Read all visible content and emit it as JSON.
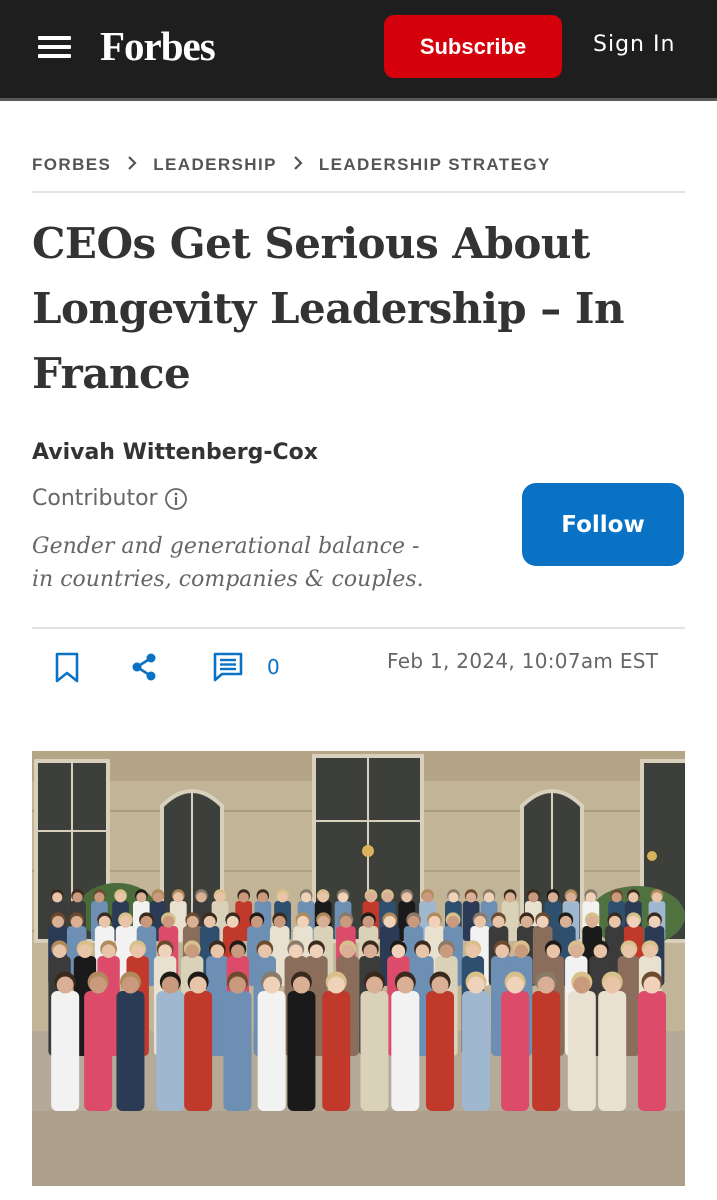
{
  "header": {
    "logo": "Forbes",
    "subscribe_label": "Subscribe",
    "signin_label": "Sign In"
  },
  "breadcrumb": [
    "FORBES",
    "LEADERSHIP",
    "LEADERSHIP STRATEGY"
  ],
  "article": {
    "headline_lines": [
      "CEOs Get Serious About",
      "Longevity Leadership – In",
      "France"
    ],
    "author": "Avivah Wittenberg-Cox",
    "role": "Contributor",
    "tagline_lines": [
      "Gender and generational balance -",
      "in countries, companies & couples."
    ],
    "follow_label": "Follow",
    "comment_count": "0",
    "date": "Feb 1, 2024, 10:07am EST"
  },
  "colors": {
    "header_bg": "#1e1e1e",
    "subscribe_bg": "#d4000b",
    "follow_bg": "#0a72c4",
    "icon_blue": "#0a72c4"
  },
  "icons": [
    "menu-icon",
    "info-icon",
    "bookmark-icon",
    "share-icon",
    "comment-icon"
  ]
}
